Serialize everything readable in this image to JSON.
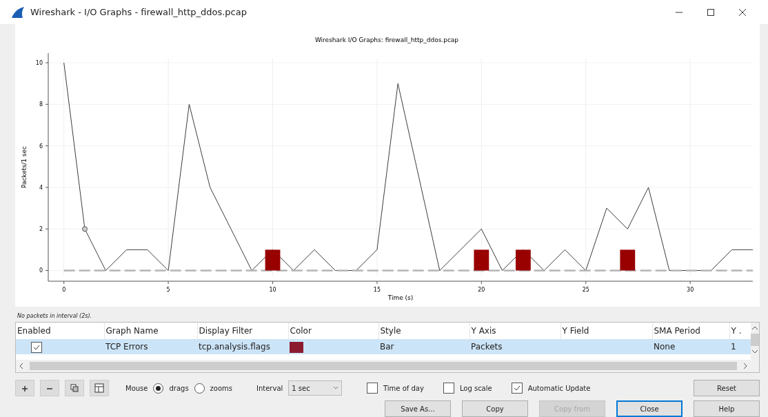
{
  "window": {
    "title": "Wireshark - I/O Graphs - firewall_http_ddos.pcap"
  },
  "graph": {
    "chart_data": {
      "type": "line",
      "title": "Wireshark I/O Graphs: firewall_http_ddos.pcap",
      "xlabel": "Time (s)",
      "ylabel": "Packets/1 sec",
      "x": [
        0,
        1,
        2,
        3,
        4,
        5,
        6,
        7,
        8,
        9,
        10,
        11,
        12,
        13,
        14,
        15,
        16,
        17,
        18,
        19,
        20,
        21,
        22,
        23,
        24,
        25,
        26,
        27,
        28,
        29,
        30,
        31,
        32,
        33
      ],
      "series": [
        {
          "color": "#3c3c3c",
          "values": [
            10,
            2,
            0,
            1,
            1,
            0,
            8,
            4,
            2,
            0,
            1,
            0,
            1,
            0,
            0,
            1,
            9,
            4.5,
            0,
            1,
            2,
            0,
            1,
            0,
            1,
            0,
            3,
            2,
            4,
            0,
            0,
            0,
            1,
            1
          ]
        },
        {
          "color": "#b4b4b4",
          "line_style": "dashed",
          "values": [
            0,
            0,
            0,
            0,
            0,
            0,
            0,
            0,
            0,
            0,
            0,
            0,
            0,
            0,
            0,
            0,
            0,
            0,
            0,
            0,
            0,
            0,
            0,
            0,
            0,
            0,
            0,
            0,
            0,
            0,
            0,
            0,
            0,
            0
          ]
        },
        {
          "type": "bar",
          "color": "#990000",
          "values": [
            0,
            0,
            0,
            0,
            0,
            0,
            0,
            0,
            0,
            0,
            1,
            0,
            0,
            0,
            0,
            0,
            0,
            0,
            0,
            0,
            1,
            0,
            1,
            0,
            0,
            0,
            0,
            1,
            0,
            0,
            0,
            0,
            0,
            0
          ]
        }
      ],
      "grid": true,
      "xlim": [
        -0.75,
        33
      ],
      "ylim": [
        -0.25,
        10.2
      ],
      "xticks": [
        0,
        5,
        10,
        15,
        20,
        25,
        30
      ],
      "yticks": [
        0,
        2,
        4,
        6,
        8,
        10
      ]
    }
  },
  "status": "No packets in interval (2s).",
  "table": {
    "columns": [
      "Enabled",
      "Graph Name",
      "Display Filter",
      "Color",
      "Style",
      "Y Axis",
      "Y Field",
      "SMA Period",
      "Y ."
    ],
    "rows": [
      {
        "enabled": true,
        "selected": true,
        "graph_name": "TCP Errors",
        "display_filter": "tcp.analysis.flags",
        "color": "#8b1a2e",
        "style": "Bar",
        "y_axis": "Packets",
        "sma_period": "None",
        "column_9": "1"
      }
    ]
  },
  "mouse": {
    "label": "Mouse",
    "options": [
      {
        "label": "drags",
        "selected": true
      },
      {
        "label": "zooms",
        "selected": false
      }
    ]
  },
  "interval": {
    "label": "Interval",
    "value": "1 sec"
  },
  "options": [
    {
      "label": "Time of day",
      "checked": false
    },
    {
      "label": "Log scale",
      "checked": false
    },
    {
      "label": "Automatic Update",
      "checked": true
    }
  ],
  "reset": "Reset",
  "buttons": [
    {
      "label": "Save As...",
      "disabled": false,
      "default": false
    },
    {
      "label": "Copy",
      "disabled": false,
      "default": false
    },
    {
      "label": "Copy from",
      "disabled": true,
      "default": false
    },
    {
      "label": "Close",
      "disabled": false,
      "default": true
    },
    {
      "label": "Help",
      "disabled": false,
      "default": false
    }
  ]
}
